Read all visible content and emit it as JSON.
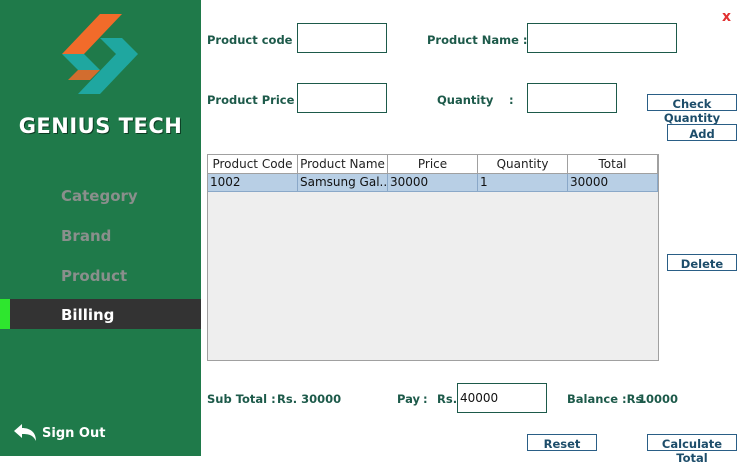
{
  "sidebar": {
    "brand": "GENIUS TECH",
    "items": [
      {
        "label": "Category"
      },
      {
        "label": "Brand"
      },
      {
        "label": "Product"
      },
      {
        "label": "Billing"
      }
    ],
    "signout": "Sign Out"
  },
  "form": {
    "close": "x",
    "product_code_label": "Product code :",
    "product_code_value": "",
    "product_name_label": "Product Name :",
    "product_name_value": "",
    "product_price_label": "Product Price :",
    "product_price_value": "",
    "quantity_label": "Quantity",
    "quantity_colon": ":",
    "quantity_value": "",
    "check_quantity": "Check Quantity",
    "add": "Add",
    "delete": "Delete"
  },
  "table": {
    "columns": [
      "Product Code",
      "Product Name",
      "Price",
      "Quantity",
      "Total"
    ],
    "rows": [
      [
        "1002",
        "Samsung Gal...",
        "30000",
        "1",
        "30000"
      ]
    ]
  },
  "totals": {
    "subtotal_label": "Sub Total :",
    "subtotal_value": "Rs. 30000",
    "pay_label": "Pay",
    "pay_colon": ":",
    "pay_rs": "Rs.",
    "pay_value": "40000",
    "balance_label": "Balance :Rs.",
    "balance_value": "10000",
    "reset": "Reset",
    "calculate_total": "Calculate Total"
  },
  "colors": {
    "sidebar_green": "#1f7a4a",
    "active_marker": "#2ee62e",
    "label_teal": "#1d5a4a",
    "close_red": "#e23232",
    "row_selected": "#b8cfe5"
  }
}
